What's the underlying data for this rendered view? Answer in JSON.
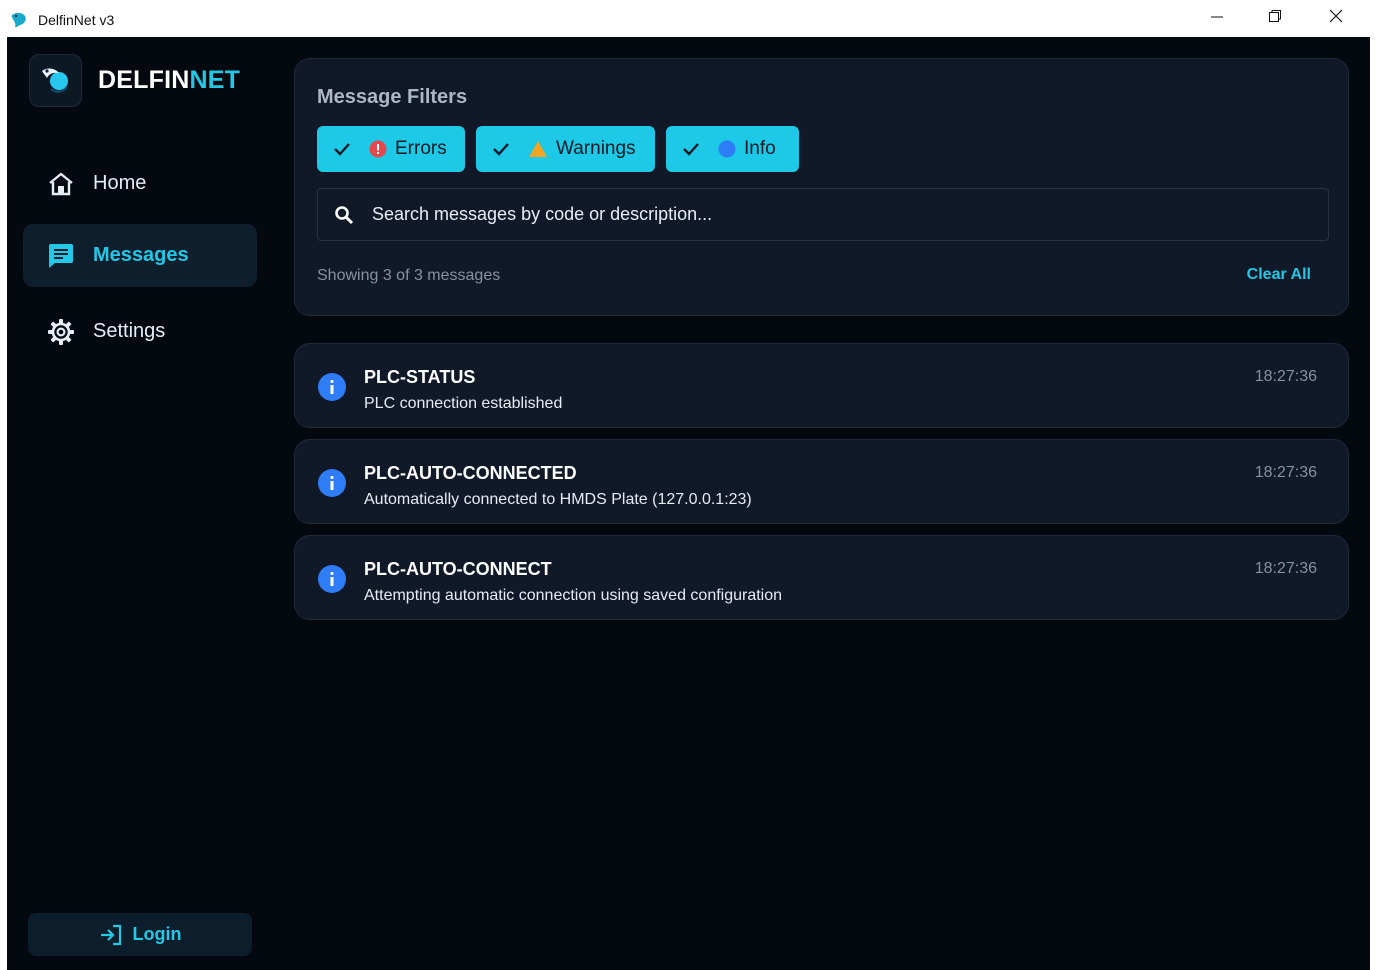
{
  "window": {
    "title": "DelfinNet v3",
    "controls": [
      "minimize-icon",
      "restore-icon",
      "close-icon"
    ]
  },
  "brand": {
    "name_part1": "DELFIN",
    "name_part2": "NET",
    "accent_color": "#22c8e6"
  },
  "sidebar": {
    "items": [
      {
        "label": "Home",
        "icon": "home-icon",
        "active": false
      },
      {
        "label": "Messages",
        "icon": "message-icon",
        "active": true
      },
      {
        "label": "Settings",
        "icon": "gear-icon",
        "active": false
      }
    ],
    "login_label": "Login"
  },
  "filters": {
    "title": "Message Filters",
    "chips": [
      {
        "label": "Errors",
        "checked": true,
        "dot_color": "#e5484d",
        "icon": "error-dot-icon"
      },
      {
        "label": "Warnings",
        "checked": true,
        "dot_color": "#f5a524",
        "icon": "warning-triangle-icon"
      },
      {
        "label": "Info",
        "checked": true,
        "dot_color": "#2f7df6",
        "icon": "info-dot-icon"
      }
    ],
    "search_placeholder": "Search messages by code or description...",
    "count_text": "Showing 3 of 3 messages",
    "clear_label": "Clear All"
  },
  "messages": [
    {
      "code": "PLC-STATUS",
      "description": "PLC connection established",
      "time": "18:27:36",
      "level": "info"
    },
    {
      "code": "PLC-AUTO-CONNECTED",
      "description": "Automatically connected to HMDS Plate (127.0.0.1:23)",
      "time": "18:27:36",
      "level": "info"
    },
    {
      "code": "PLC-AUTO-CONNECT",
      "description": "Attempting automatic connection using saved configuration",
      "time": "18:27:36",
      "level": "info"
    }
  ],
  "colors": {
    "background": "#04080f",
    "card": "#111827",
    "accent": "#22c8e6",
    "info": "#2f7df6"
  }
}
